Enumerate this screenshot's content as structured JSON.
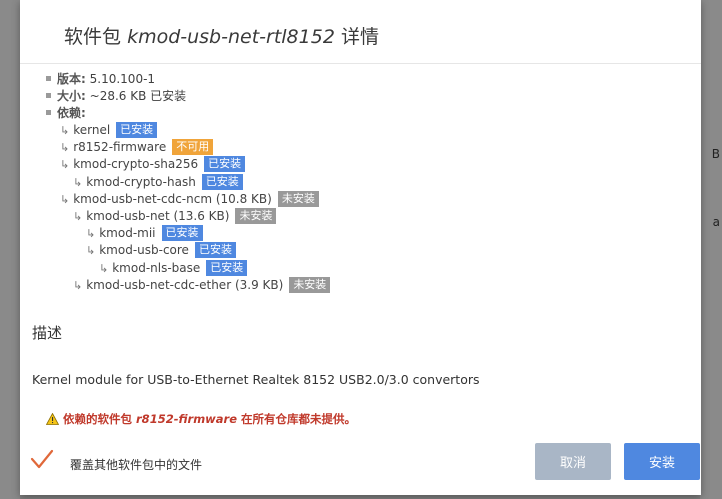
{
  "background": {
    "right_glyph_1": "B",
    "right_glyph_2": "a"
  },
  "dialog": {
    "title_prefix": "软件包",
    "title_package": "kmod-usb-net-rtl8152",
    "title_suffix": "详情",
    "meta": [
      {
        "label": "版本:",
        "value": "5.10.100-1"
      },
      {
        "label": "大小:",
        "value": "~28.6 KB 已安装"
      },
      {
        "label": "依赖:",
        "value": ""
      }
    ],
    "deps": [
      {
        "name": "kernel",
        "status": "已安装",
        "status_type": "installed",
        "level": 0
      },
      {
        "name": "r8152-firmware",
        "status": "不可用",
        "status_type": "unavailable",
        "level": 0
      },
      {
        "name": "kmod-crypto-sha256",
        "status": "已安装",
        "status_type": "installed",
        "level": 0
      },
      {
        "name": "kmod-crypto-hash",
        "status": "已安装",
        "status_type": "installed",
        "level": 1
      },
      {
        "name": "kmod-usb-net-cdc-ncm (10.8 KB)",
        "status": "未安装",
        "status_type": "not-installed",
        "level": 0
      },
      {
        "name": "kmod-usb-net (13.6 KB)",
        "status": "未安装",
        "status_type": "not-installed",
        "level": 1
      },
      {
        "name": "kmod-mii",
        "status": "已安装",
        "status_type": "installed",
        "level": 2
      },
      {
        "name": "kmod-usb-core",
        "status": "已安装",
        "status_type": "installed",
        "level": 2
      },
      {
        "name": "kmod-nls-base",
        "status": "已安装",
        "status_type": "installed",
        "level": 3
      },
      {
        "name": "kmod-usb-net-cdc-ether (3.9 KB)",
        "status": "未安装",
        "status_type": "not-installed",
        "level": 1
      }
    ],
    "description_heading": "描述",
    "description": "Kernel module for USB-to-Ethernet Realtek 8152 USB2.0/3.0 convertors",
    "warning": {
      "prefix": "依赖的软件包",
      "package": "r8152-firmware",
      "suffix": "在所有仓库都未提供。"
    },
    "overwrite_checkbox_label": "覆盖其他软件包中的文件",
    "overwrite_checked": true,
    "cancel_label": "取消",
    "install_label": "安装"
  },
  "colors": {
    "installed": "#4f88e0",
    "unavailable": "#f0a43a",
    "not_installed": "#999999",
    "warning": "#c0392b",
    "check": "#e0683a"
  }
}
